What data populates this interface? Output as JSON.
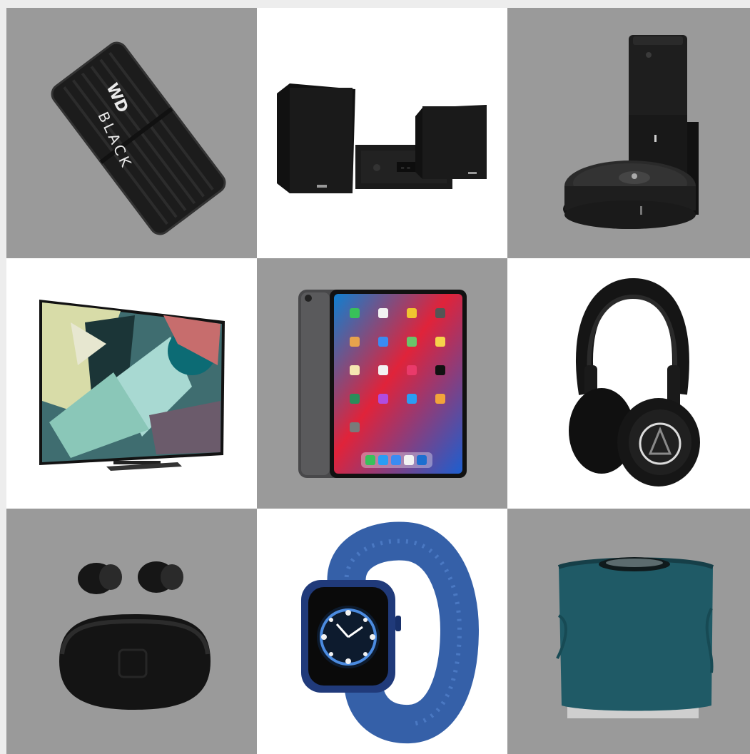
{
  "products": [
    {
      "id": "portable-hard-drive",
      "bg": "gray",
      "brand_text": [
        "WD",
        "BLACK"
      ]
    },
    {
      "id": "micro-hifi-system",
      "bg": "white"
    },
    {
      "id": "robot-vacuum",
      "bg": "gray"
    },
    {
      "id": "qled-tv",
      "bg": "white"
    },
    {
      "id": "tablet",
      "bg": "gray"
    },
    {
      "id": "headphones",
      "bg": "white"
    },
    {
      "id": "wireless-earbuds",
      "bg": "gray"
    },
    {
      "id": "smartwatch",
      "bg": "white"
    },
    {
      "id": "wireless-speaker",
      "bg": "gray"
    }
  ],
  "colors": {
    "gray_tile": "#9a9a9a",
    "white_tile": "#ffffff",
    "page_bg": "#ededed",
    "watch_band": "#3560a8",
    "speaker_fabric": "#1f5a66"
  }
}
